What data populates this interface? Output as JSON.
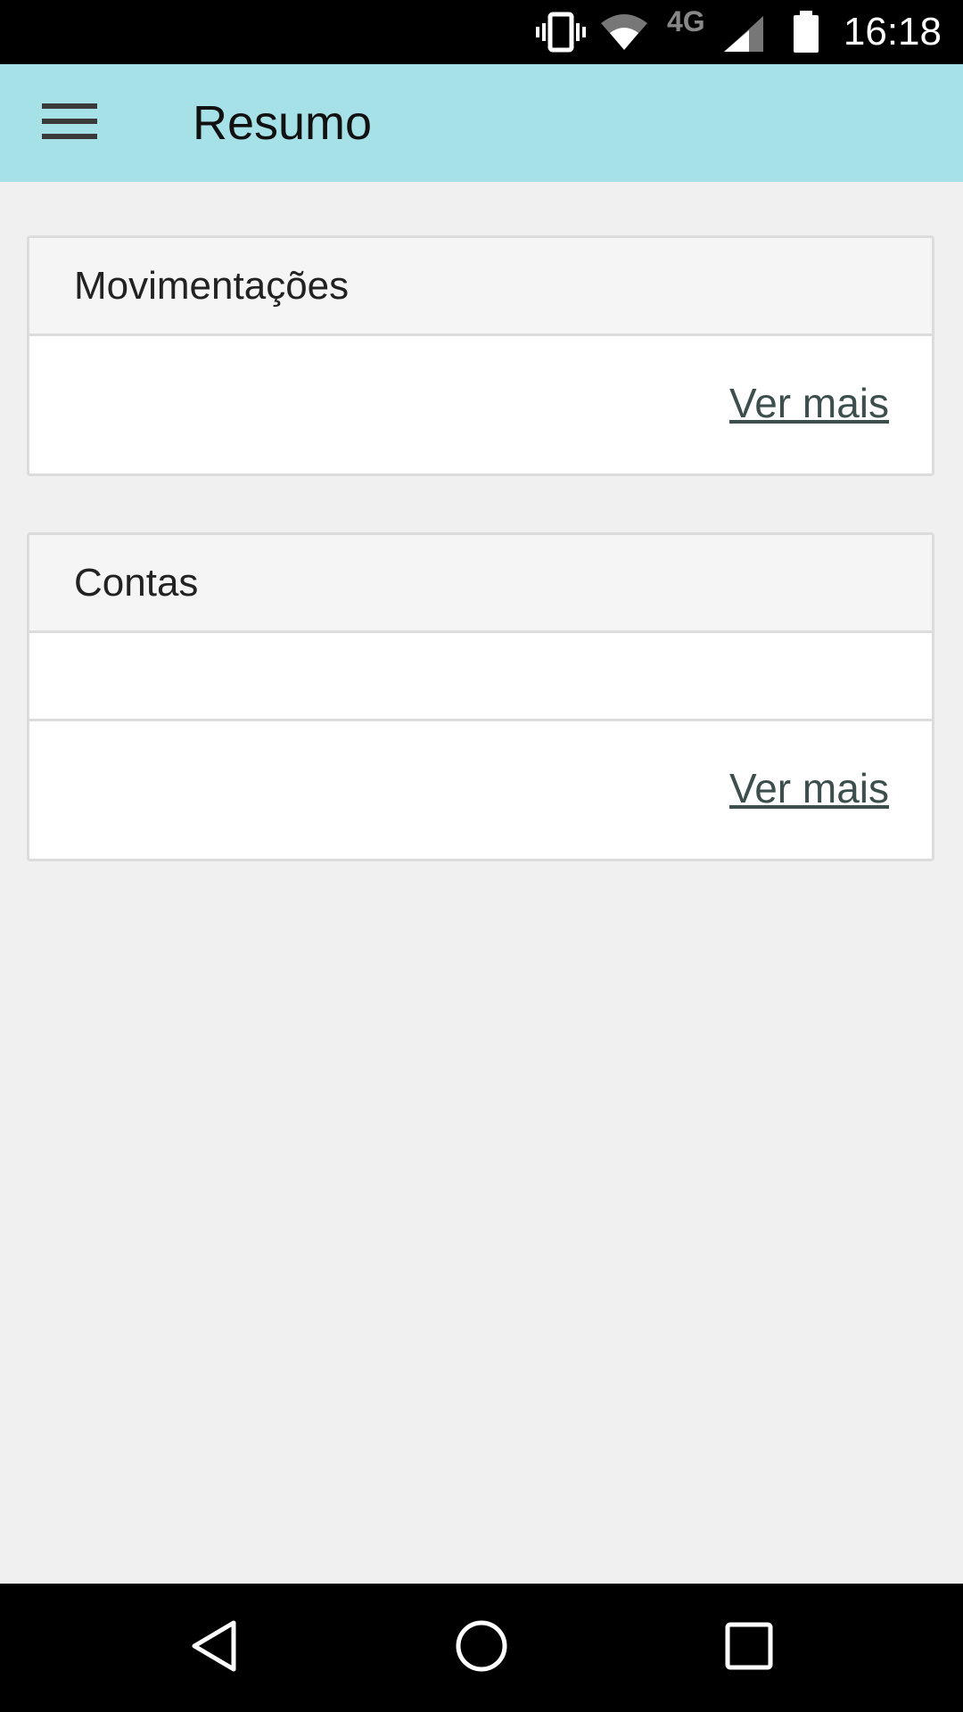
{
  "status_bar": {
    "network_label": "4G",
    "time": "16:18",
    "icons": [
      "vibrate-icon",
      "wifi-icon",
      "cell-signal-icon",
      "battery-icon"
    ]
  },
  "app_bar": {
    "title": "Resumo",
    "menu_icon": "hamburger-menu-icon",
    "background_color": "#a7e1e8"
  },
  "cards": {
    "movimentacoes": {
      "title": "Movimentações",
      "link": "Ver mais"
    },
    "contas": {
      "title": "Contas",
      "link": "Ver mais"
    }
  },
  "nav_bar": {
    "icons": [
      "back-icon",
      "home-icon",
      "recents-icon"
    ]
  }
}
